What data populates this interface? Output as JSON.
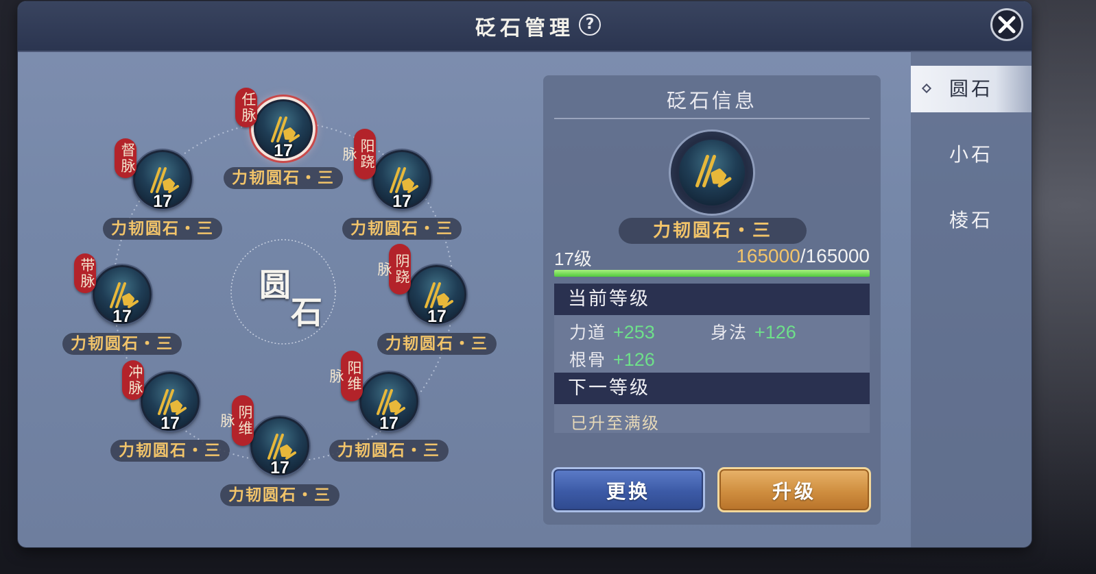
{
  "window": {
    "title": "砭石管理"
  },
  "tabs": [
    {
      "label": "圆石",
      "active": true
    },
    {
      "label": "小石",
      "active": false
    },
    {
      "label": "棱石",
      "active": false
    }
  ],
  "center": {
    "char1": "圆",
    "char2": "石"
  },
  "stones": [
    {
      "meridian": "任脉",
      "name": "力韧圆石・三",
      "level": "17",
      "selected": true
    },
    {
      "meridian": "阳跷脉",
      "name": "力韧圆石・三",
      "level": "17"
    },
    {
      "meridian": "阴跷脉",
      "name": "力韧圆石・三",
      "level": "17"
    },
    {
      "meridian": "阳维脉",
      "name": "力韧圆石・三",
      "level": "17"
    },
    {
      "meridian": "阴维脉",
      "name": "力韧圆石・三",
      "level": "17"
    },
    {
      "meridian": "冲脉",
      "name": "力韧圆石・三",
      "level": "17"
    },
    {
      "meridian": "带脉",
      "name": "力韧圆石・三",
      "level": "17"
    },
    {
      "meridian": "督脉",
      "name": "力韧圆石・三",
      "level": "17"
    }
  ],
  "info": {
    "title": "砭石信息",
    "name": "力韧圆石・三",
    "level_text": "17级",
    "exp_current": "165000",
    "exp_max": "/165000",
    "exp_fraction": 1.0,
    "current_section": "当前等级",
    "stats": [
      {
        "label": "力道",
        "value": "+253"
      },
      {
        "label": "身法",
        "value": "+126"
      },
      {
        "label": "根骨",
        "value": "+126"
      }
    ],
    "next_section": "下一等级",
    "maxed_text": "已升至满级"
  },
  "buttons": {
    "swap": "更换",
    "upgrade": "升级"
  },
  "colors": {
    "accent_gold": "#f2c46a",
    "stat_green": "#6ee08a",
    "tag_red": "#b3232a"
  }
}
